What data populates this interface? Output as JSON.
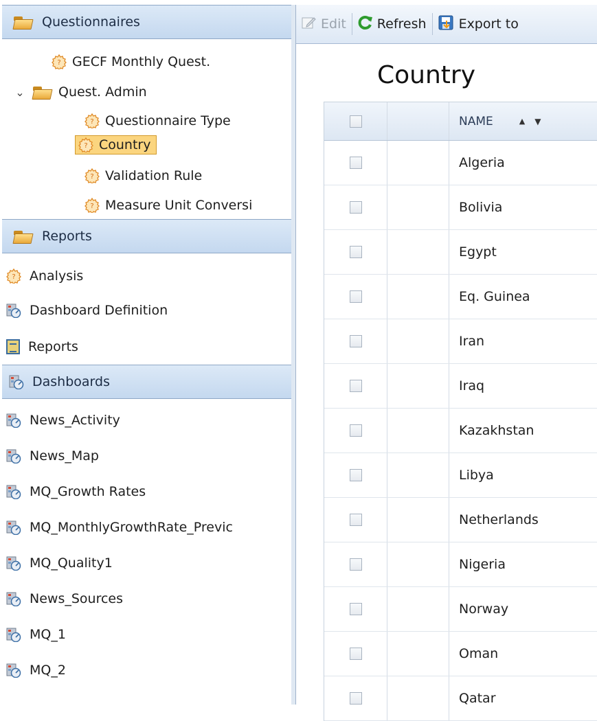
{
  "nav": {
    "questionnaires_header": "Questionnaires",
    "tree": [
      {
        "label": "GECF Monthly Quest."
      },
      {
        "label": "Quest. Admin"
      },
      {
        "label": "Questionnaire Type"
      },
      {
        "label": "Country"
      },
      {
        "label": "Validation Rule"
      },
      {
        "label": "Measure Unit Conversi"
      }
    ],
    "reports_header": "Reports",
    "reports_items": [
      "Analysis",
      "Dashboard Definition",
      "Reports"
    ],
    "dashboards_header": "Dashboards",
    "dashboards_items": [
      "News_Activity",
      "News_Map",
      "MQ_Growth Rates",
      "MQ_MonthlyGrowthRate_Previc",
      "MQ_Quality1",
      "News_Sources",
      "MQ_1",
      "MQ_2"
    ]
  },
  "toolbar": {
    "edit_label": "Edit",
    "refresh_label": "Refresh",
    "export_label": "Export to"
  },
  "page": {
    "title": "Country"
  },
  "grid": {
    "name_header": "NAME",
    "rows": [
      "Algeria",
      "Bolivia",
      "Egypt",
      "Eq. Guinea",
      "Iran",
      "Iraq",
      "Kazakhstan",
      "Libya",
      "Netherlands",
      "Nigeria",
      "Norway",
      "Oman",
      "Qatar"
    ]
  },
  "colors": {
    "header_bg": "#c4d8ef",
    "selected_bg": "#fbd57f",
    "refresh_green": "#2e9b2e"
  }
}
